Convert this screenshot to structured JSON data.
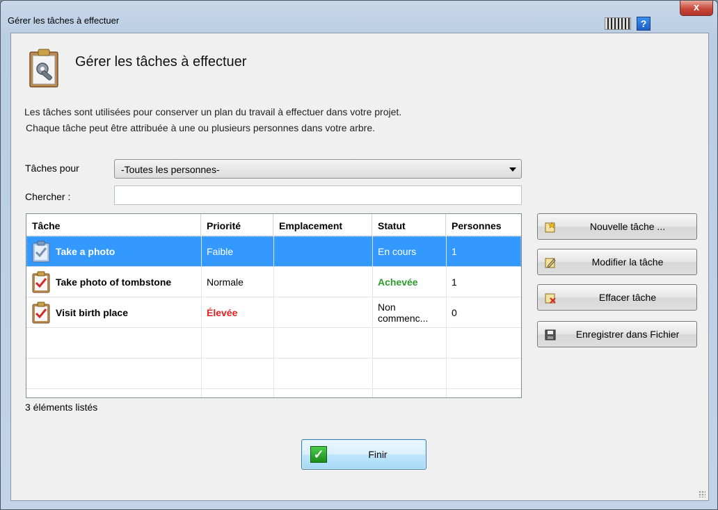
{
  "window": {
    "title": "Gérer les tâches à effectuer",
    "close_label": "x",
    "help_label": "?"
  },
  "header": {
    "title": "Gérer les tâches à effectuer",
    "description_line1": "Les tâches sont utilisées pour conserver un plan du travail à effectuer dans votre projet.",
    "description_line2": "Chaque tâche peut être attribuée à une ou plusieurs personnes dans votre arbre."
  },
  "filters": {
    "tasks_for_label": "Tâches pour",
    "tasks_for_value": "-Toutes les personnes-",
    "search_label": "Chercher :",
    "search_value": ""
  },
  "table": {
    "columns": [
      "Tâche",
      "Priorité",
      "Emplacement",
      "Statut",
      "Personnes"
    ],
    "rows": [
      {
        "task": "Take a photo",
        "priority": "Faible",
        "location": "",
        "status": "En cours",
        "status_line2": "",
        "people": "1",
        "selected": true
      },
      {
        "task": "Take photo of tombstone",
        "priority": "Normale",
        "location": "",
        "status": "Achevée",
        "status_line2": "",
        "people": "1",
        "selected": false
      },
      {
        "task": "Visit birth place",
        "priority": "Élevée",
        "location": "",
        "status": "Non",
        "status_line2": "commenc...",
        "people": "0",
        "selected": false
      }
    ]
  },
  "count_label": "3 éléments listés",
  "buttons": {
    "new_task": "Nouvelle tâche ...",
    "edit_task": "Modifier la tâche",
    "delete_task": "Effacer tâche",
    "save_file": "Enregistrer dans Fichier",
    "finish": "Finir"
  },
  "colors": {
    "selection": "#3399ff",
    "priority_high": "#e02020",
    "status_done": "#2a9a2a"
  },
  "icons": [
    "clipboard-tools-icon",
    "keyboard-icon",
    "help-icon",
    "close-icon",
    "task-clipboard-icon",
    "new-task-icon",
    "edit-task-icon",
    "delete-task-icon",
    "save-icon",
    "checkmark-icon"
  ]
}
